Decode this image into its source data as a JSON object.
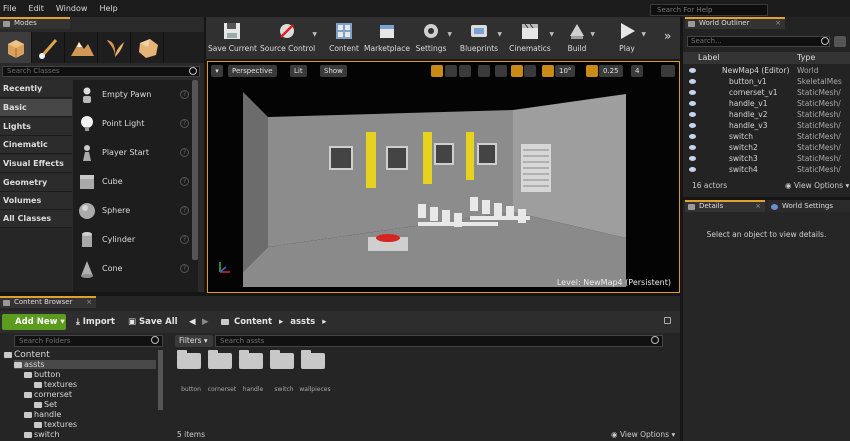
{
  "menu": [
    "File",
    "Edit",
    "Window",
    "Help"
  ],
  "help_search_placeholder": "Search For Help",
  "modes": {
    "tab": "Modes",
    "search_placeholder": "Search Classes",
    "categories": [
      "Recently Placed",
      "Basic",
      "Lights",
      "Cinematic",
      "Visual Effects",
      "Geometry",
      "Volumes",
      "All Classes"
    ],
    "selected_category": "Basic",
    "items": [
      "Empty Pawn",
      "Point Light",
      "Player Start",
      "Cube",
      "Sphere",
      "Cylinder",
      "Cone"
    ]
  },
  "toolbar": {
    "buttons": [
      "Save Current",
      "Source Control",
      "Content",
      "Marketplace",
      "Settings",
      "Blueprints",
      "Cinematics",
      "Build",
      "Play"
    ]
  },
  "viewport": {
    "perspective": "Perspective",
    "lit": "Lit",
    "show": "Show",
    "angle": "10°",
    "scale": "0.25",
    "cam_speed": "4",
    "level_prefix": "Level:",
    "level_name": "NewMap4 (Persistent)"
  },
  "outliner": {
    "tab": "World Outliner",
    "search_placeholder": "Search...",
    "col_label": "Label",
    "col_type": "Type",
    "rows": [
      {
        "label": "NewMap4 (Editor)",
        "type": "World"
      },
      {
        "label": "button_v1",
        "type": "SkeletalMes"
      },
      {
        "label": "cornerset_v1",
        "type": "StaticMesh/"
      },
      {
        "label": "handle_v1",
        "type": "StaticMesh/"
      },
      {
        "label": "handle_v2",
        "type": "StaticMesh/"
      },
      {
        "label": "handle_v3",
        "type": "StaticMesh/"
      },
      {
        "label": "switch",
        "type": "StaticMesh/"
      },
      {
        "label": "switch2",
        "type": "StaticMesh/"
      },
      {
        "label": "switch3",
        "type": "StaticMesh/"
      },
      {
        "label": "switch4",
        "type": "StaticMesh/"
      }
    ],
    "actor_count": "16 actors",
    "view_options": "View Options"
  },
  "details": {
    "tab": "Details",
    "world_settings_tab": "World Settings",
    "message": "Select an object to view details."
  },
  "content_browser": {
    "tab": "Content Browser",
    "add_new": "Add New",
    "import": "Import",
    "save_all": "Save All",
    "path": [
      "Content",
      "assts"
    ],
    "folder_search": "Search Folders",
    "filters": "Filters",
    "asset_search": "Search assts",
    "tree": [
      {
        "label": "Content",
        "level": 0
      },
      {
        "label": "assts",
        "level": 1
      },
      {
        "label": "button",
        "level": 2
      },
      {
        "label": "textures",
        "level": 3
      },
      {
        "label": "cornerset",
        "level": 2
      },
      {
        "label": "Set",
        "level": 3
      },
      {
        "label": "handle",
        "level": 2
      },
      {
        "label": "textures",
        "level": 3
      },
      {
        "label": "switch",
        "level": 2
      }
    ],
    "assets": [
      "button",
      "cornerset",
      "handle",
      "switch",
      "wallpieces"
    ],
    "item_count": "5 items",
    "view_options": "View Options"
  }
}
